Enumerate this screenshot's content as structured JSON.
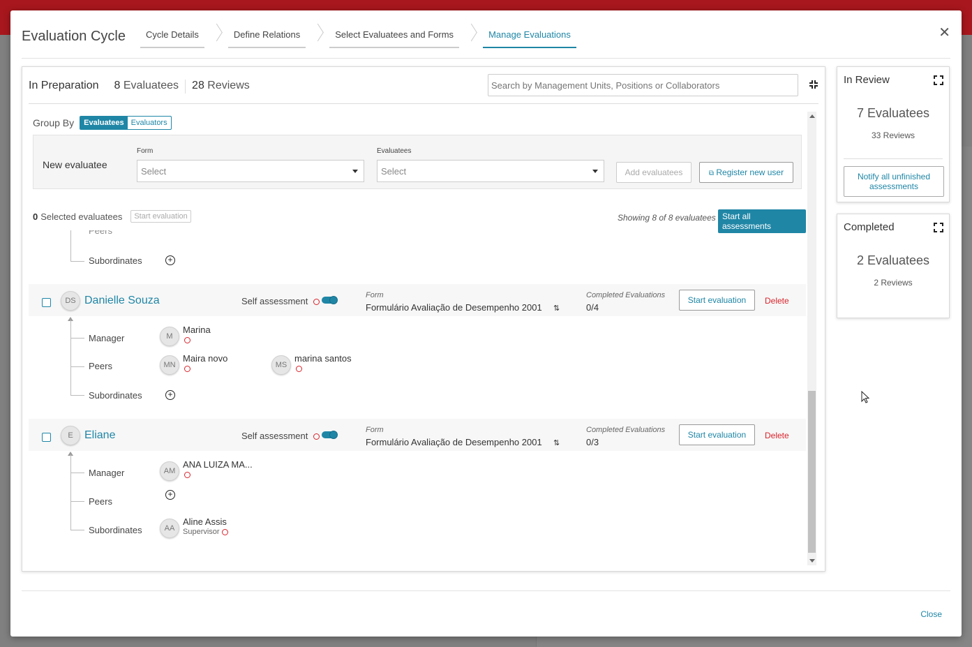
{
  "header": {
    "title": "Evaluation Cycle",
    "steps": [
      {
        "label": "Cycle Details"
      },
      {
        "label": "Define Relations"
      },
      {
        "label": "Select Evaluatees and Forms"
      },
      {
        "label": "Manage Evaluations"
      }
    ],
    "active_step": 3,
    "close_icon": "close-icon"
  },
  "main": {
    "title": "In Preparation",
    "evaluatees_count": "8",
    "evaluatees_label": "Evaluatees",
    "reviews_count": "28",
    "reviews_label": "Reviews",
    "search_placeholder": "Search by Management Units, Positions or Collaborators",
    "group_by_label": "Group By",
    "group_by_options": [
      "Evaluatees",
      "Evaluators"
    ],
    "new_evaluatee": {
      "title": "New evaluatee",
      "form_label": "Form",
      "form_value": "Select",
      "evaluatees_label": "Evaluatees",
      "evaluatees_value": "Select",
      "add_button": "Add evaluatees",
      "register_button": "Register new user"
    },
    "selected_count": "0",
    "selected_label": "Selected evaluatees",
    "start_evaluation_top": "Start evaluation",
    "showing_text": "Showing 8 of 8 evaluatees",
    "start_all_button": "Start all assessments",
    "partial": {
      "peers_label": "Peers",
      "subordinates_label": "Subordinates"
    },
    "evaluatees": [
      {
        "initials": "DS",
        "name": "Danielle Souza",
        "self_label": "Self assessment",
        "form_label": "Form",
        "form_value": "Formulário Avaliação de Desempenho 2001",
        "completed_label": "Completed Evaluations",
        "completed_value": "0/4",
        "start_button": "Start evaluation",
        "delete_label": "Delete",
        "manager_label": "Manager",
        "peers_label": "Peers",
        "subordinates_label": "Subordinates",
        "manager": [
          {
            "initials": "M",
            "name": "Marina"
          }
        ],
        "peers": [
          {
            "initials": "MN",
            "name": "Maira novo"
          },
          {
            "initials": "MS",
            "name": "marina santos"
          }
        ],
        "subordinates": []
      },
      {
        "initials": "E",
        "name": "Eliane",
        "self_label": "Self assessment",
        "form_label": "Form",
        "form_value": "Formulário Avaliação de Desempenho 2001",
        "completed_label": "Completed Evaluations",
        "completed_value": "0/3",
        "start_button": "Start evaluation",
        "delete_label": "Delete",
        "manager_label": "Manager",
        "peers_label": "Peers",
        "subordinates_label": "Subordinates",
        "manager": [
          {
            "initials": "AM",
            "name": "ANA LUIZA MA..."
          }
        ],
        "peers": [],
        "subordinates": [
          {
            "initials": "AA",
            "name": "Aline Assis",
            "role": "Supervisor"
          }
        ]
      }
    ]
  },
  "in_review": {
    "title": "In Review",
    "evaluatees": "7 Evaluatees",
    "reviews": "33 Reviews",
    "notify_button": "Notify all unfinished assessments"
  },
  "completed": {
    "title": "Completed",
    "evaluatees": "2 Evaluatees",
    "reviews": "2 Reviews"
  },
  "footer": {
    "close_label": "Close"
  },
  "colors": {
    "accent": "#1f86a6",
    "danger": "#d9232b",
    "brand_bar": "#a7171d"
  }
}
